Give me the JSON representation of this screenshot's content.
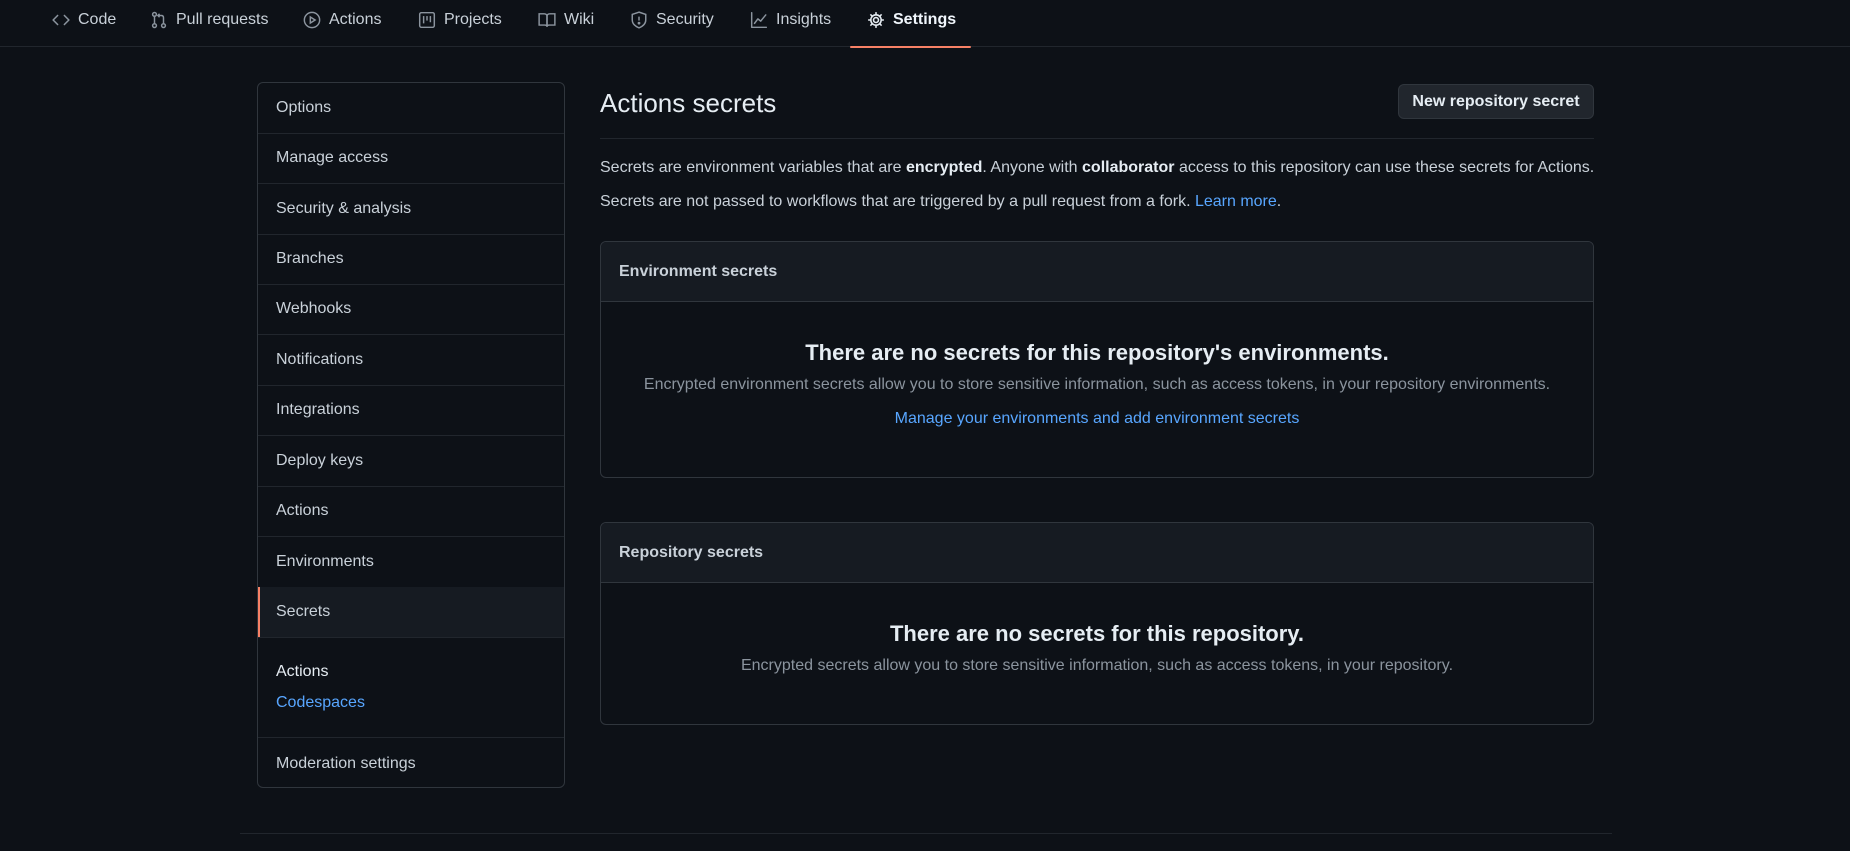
{
  "nav": {
    "tabs": [
      {
        "label": "Code",
        "icon": "code-icon"
      },
      {
        "label": "Pull requests",
        "icon": "git-pull-request-icon"
      },
      {
        "label": "Actions",
        "icon": "play-icon"
      },
      {
        "label": "Projects",
        "icon": "project-icon"
      },
      {
        "label": "Wiki",
        "icon": "book-icon"
      },
      {
        "label": "Security",
        "icon": "shield-icon"
      },
      {
        "label": "Insights",
        "icon": "graph-icon"
      },
      {
        "label": "Settings",
        "icon": "gear-icon",
        "active": true
      }
    ]
  },
  "sidebar": {
    "items": [
      {
        "label": "Options"
      },
      {
        "label": "Manage access"
      },
      {
        "label": "Security & analysis"
      },
      {
        "label": "Branches"
      },
      {
        "label": "Webhooks"
      },
      {
        "label": "Notifications"
      },
      {
        "label": "Integrations"
      },
      {
        "label": "Deploy keys"
      },
      {
        "label": "Actions"
      },
      {
        "label": "Environments"
      },
      {
        "label": "Secrets",
        "selected": true
      }
    ],
    "sub_items": [
      {
        "label": "Actions"
      },
      {
        "label": "Codespaces"
      }
    ],
    "last_item": "Moderation settings"
  },
  "main": {
    "title": "Actions secrets",
    "new_button": "New repository secret",
    "para1": {
      "t1": "Secrets are environment variables that are ",
      "b1": "encrypted",
      "t2": ". Anyone with ",
      "b2": "collaborator",
      "t3": " access to this repository can use these secrets for Actions."
    },
    "para2": {
      "t1": "Secrets are not passed to workflows that are triggered by a pull request from a fork. ",
      "link": "Learn more",
      "t2": "."
    },
    "env_box": {
      "header": "Environment secrets",
      "title": "There are no secrets for this repository's environments.",
      "desc": "Encrypted environment secrets allow you to store sensitive information, such as access tokens, in your repository environments.",
      "link": "Manage your environments and add environment secrets"
    },
    "repo_box": {
      "header": "Repository secrets",
      "title": "There are no secrets for this repository.",
      "desc": "Encrypted secrets allow you to store sensitive information, such as access tokens, in your repository."
    }
  },
  "colors": {
    "background": "#0d1117",
    "accent_underline": "#f78166",
    "link": "#58a6ff",
    "border": "#30363d"
  }
}
